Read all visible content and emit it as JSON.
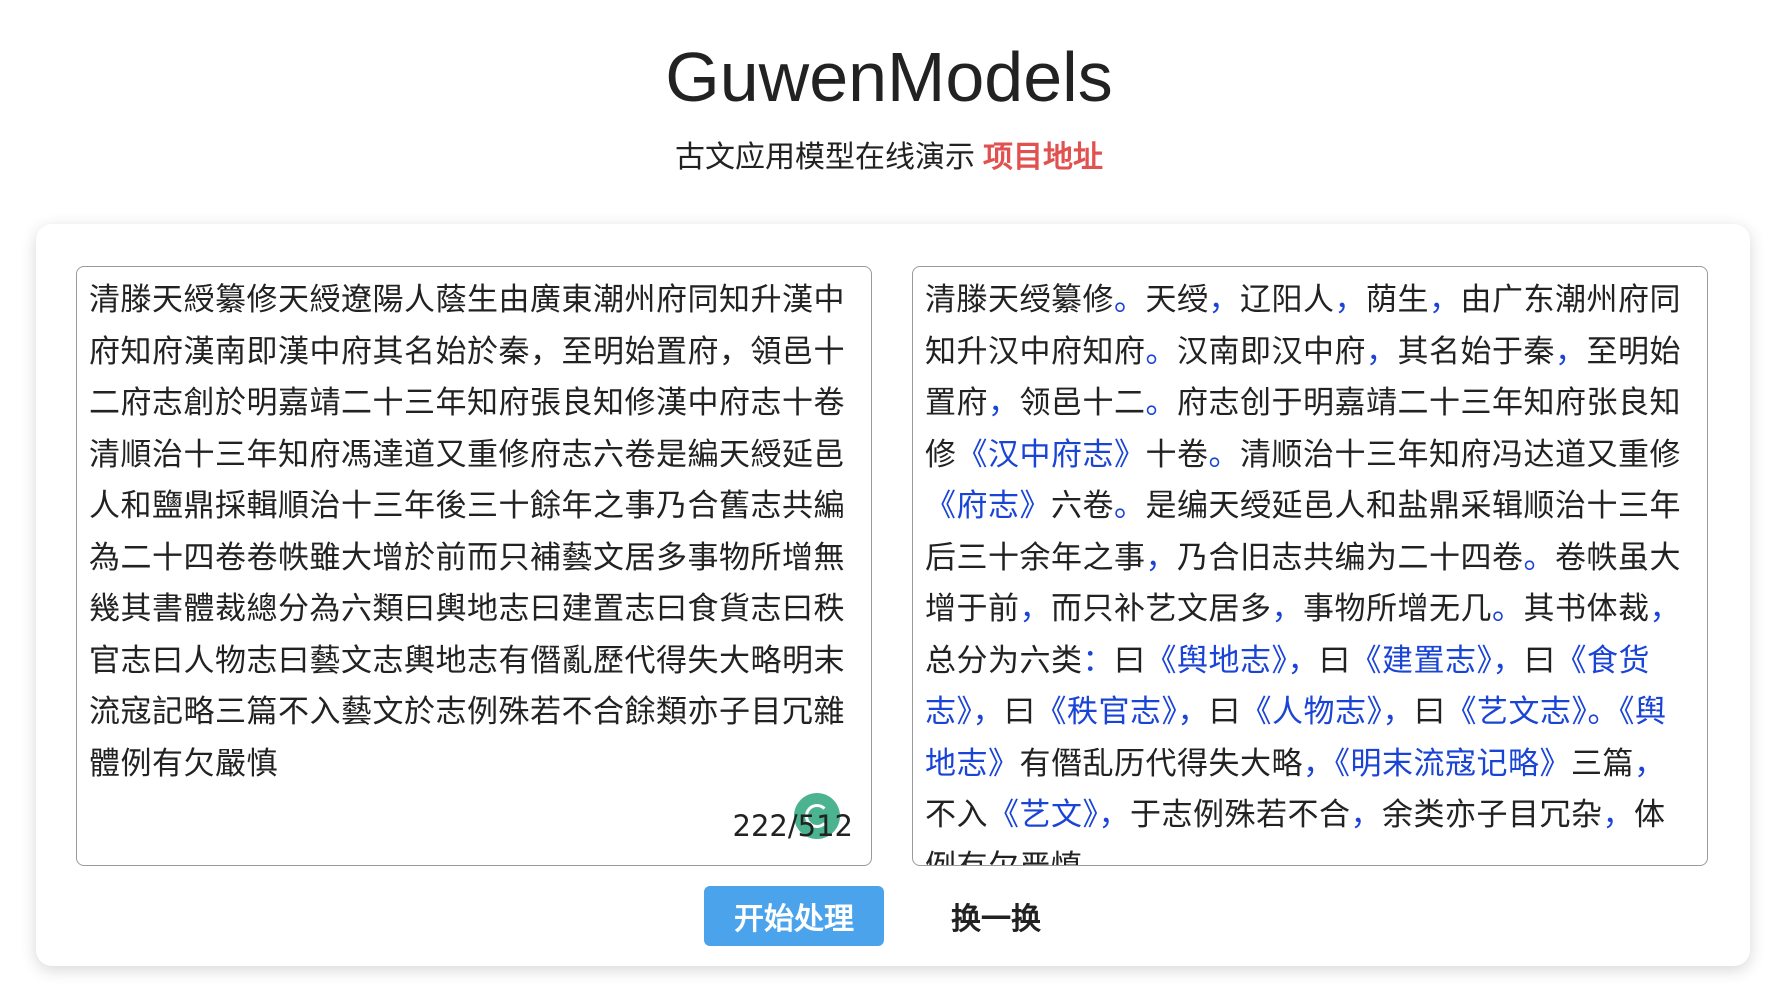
{
  "header": {
    "title": "GuwenModels",
    "subtitle": "古文应用模型在线演示",
    "link_label": "项目地址"
  },
  "input_panel": {
    "text": "清滕天綬纂修天綬遼陽人蔭生由廣東潮州府同知升漢中府知府漢南即漢中府其名始於秦，至明始置府，領邑十二府志創於明嘉靖二十三年知府張良知修漢中府志十卷清順治十三年知府馮達道又重修府志六卷是編天綬延邑人和鹽鼎採輯順治十三年後三十餘年之事乃合舊志共編為二十四卷卷帙雖大增於前而只補藝文居多事物所增無幾其書體裁總分為六類曰輿地志曰建置志曰食貨志曰秩官志曰人物志曰藝文志輿地志有僭亂歷代得失大略明末流寇記略三篇不入藝文於志例殊若不合餘類亦子目冗雜體例有欠嚴慎",
    "char_count": "222/512"
  },
  "output_panel": {
    "segments": [
      "清滕天绶纂修",
      "。",
      "天绶",
      "，",
      "辽阳人",
      "，",
      "荫生",
      "，",
      "由广东潮州府同知升汉中府知府",
      "。",
      "汉南即汉中府",
      "，",
      "其名始于秦",
      "，",
      "至明始置府",
      "，",
      "领邑十二",
      "。",
      "府志创于明嘉靖二十三年知府张良知修",
      "《汉中府志》",
      "十卷",
      "。",
      "清顺治十三年知府冯达道又重修",
      "《府志》",
      "六卷",
      "。",
      "是编天绶延邑人和盐鼎采辑顺治十三年后三十余年之事",
      "，",
      "乃合旧志共编为二十四卷",
      "。",
      "卷帙虽大增于前",
      "，",
      "而只补艺文居多",
      "，",
      "事物所增无几",
      "。",
      "其书体裁",
      "，",
      "总分为六类",
      "：",
      "曰",
      "《舆地志》，",
      "曰",
      "《建置志》，",
      "曰",
      "《食货志》，",
      "曰",
      "《秩官志》，",
      "曰",
      "《人物志》，",
      "曰",
      "《艺文志》。",
      "《舆地志》",
      "有僭乱历代得失大略",
      "，",
      "《明末流寇记略》",
      "三篇",
      "，",
      "不入",
      "《艺文》，",
      "于志例殊若不合",
      "，",
      "余类亦子目冗杂",
      "，",
      "体例有欠严慎"
    ]
  },
  "actions": {
    "start_label": "开始处理",
    "shuffle_label": "换一换"
  },
  "colors": {
    "accent": "#4ba3ec",
    "link": "#e0514f",
    "punctuation": "#1a44d6"
  }
}
